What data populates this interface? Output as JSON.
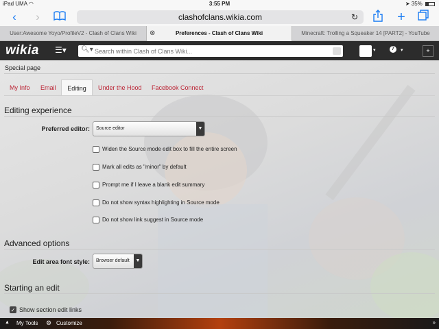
{
  "status_bar": {
    "device": "iPad",
    "carrier": "UMA",
    "time": "3:55 PM",
    "battery": "35%"
  },
  "browser": {
    "url": "clashofclans.wikia.com",
    "tabs": [
      {
        "label": "User:Awesome Yoyo/ProfileV2 - Clash of Clans Wiki"
      },
      {
        "label": "Preferences - Clash of Clans Wiki",
        "active": true
      },
      {
        "label": "Minecraft: Trolling a Squeaker 14 [PART2] - YouTube"
      }
    ]
  },
  "wikia_bar": {
    "logo": "wikia",
    "search_placeholder": "Search within Clash of Clans Wiki...",
    "notification_count": "7",
    "page_title_behind": "Preferences"
  },
  "page": {
    "subtitle": "Special page",
    "tabs": [
      {
        "label": "My Info"
      },
      {
        "label": "Email"
      },
      {
        "label": "Editing",
        "active": true
      },
      {
        "label": "Under the Hood"
      },
      {
        "label": "Facebook Connect"
      }
    ],
    "sections": {
      "editing_experience": {
        "heading": "Editing experience",
        "editor_label": "Preferred editor:",
        "editor_value": "Source editor",
        "options": [
          {
            "label": "Widen the Source mode edit box to fill the entire screen",
            "checked": false
          },
          {
            "label": "Mark all edits as \"minor\" by default",
            "checked": false
          },
          {
            "label": "Prompt me if I leave a blank edit summary",
            "checked": false
          },
          {
            "label": "Do not show syntax highlighting in Source mode",
            "checked": false
          },
          {
            "label": "Do not show link suggest in Source mode",
            "checked": false
          }
        ]
      },
      "advanced_options": {
        "heading": "Advanced options",
        "font_label": "Edit area font style:",
        "font_value": "Browser default"
      },
      "starting_an_edit": {
        "heading": "Starting an edit",
        "show_section_edit_links": {
          "label": "Show section edit links",
          "checked": true
        }
      }
    }
  },
  "toolbar": {
    "my_tools": "My Tools",
    "customize": "Customize"
  },
  "colors": {
    "link": "#bb2233",
    "wikia_bar": "#2c2c2c",
    "ios_blue": "#1a7cf3"
  }
}
